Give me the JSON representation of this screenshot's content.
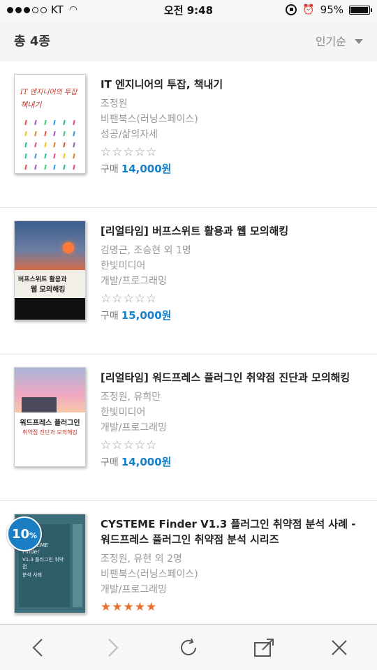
{
  "status_bar": {
    "carrier": "KT",
    "time": "오전 9:48",
    "battery_text": "95%",
    "battery_level": 0.95,
    "signal_bars_filled": 3,
    "signal_bars_total": 5
  },
  "list_header": {
    "total_label": "총 4종",
    "sort_label": "인기순"
  },
  "books": [
    {
      "title": "IT 엔지니어의 투잡, 책내기",
      "author": "조정원",
      "publisher": "비팬북스(러닝스페이스)",
      "category": "성공/삶의자세",
      "rating_filled": 0,
      "price_label": "구매",
      "price": "14,000원",
      "cover": {
        "title": "IT 엔지니어의",
        "accent": "투잡",
        "sub": "책내기"
      }
    },
    {
      "title": "[리얼타임] 버프스위트 활용과 웹 모의해킹",
      "author": "김명근, 조승현 외 1명",
      "publisher": "한빛미디어",
      "category": "개발/프로그래밍",
      "rating_filled": 0,
      "price_label": "구매",
      "price": "15,000원",
      "cover": {
        "line1": "버프스위트 활용과",
        "line2": "웹 모의해킹"
      }
    },
    {
      "title": "[리얼타임] 워드프레스 플러그인 취약점 진단과 모의해킹",
      "author": "조정원, 유희만",
      "publisher": "한빛미디어",
      "category": "개발/프로그래밍",
      "rating_filled": 0,
      "price_label": "구매",
      "price": "14,000원",
      "cover": {
        "line1": "워드프레스 플러그인",
        "line2": "취약점 진단과 모의해킹"
      }
    },
    {
      "title": "CYSTEME Finder V1.3 플러그인 취약점 분석 사례 - 워드프레스 플러그인 취약점 분석 시리즈",
      "author": "조정원, 유현 외 2명",
      "publisher": "비팬북스(러닝스페이스)",
      "category": "개발/프로그래밍",
      "rating_filled": 5,
      "discount": "10",
      "discount_unit": "%",
      "cover": {
        "line1": "CYSTEME Finder",
        "line2": "V1.3 플러그인 취약점",
        "line3": "분석 사례"
      }
    }
  ],
  "browser_bar": {
    "icons": [
      "back-icon",
      "forward-icon",
      "reload-icon",
      "share-icon",
      "close-icon"
    ]
  },
  "colors": {
    "price_blue": "#1780c8",
    "badge_blue": "#1a7ec4",
    "star_orange": "#e8702a"
  }
}
